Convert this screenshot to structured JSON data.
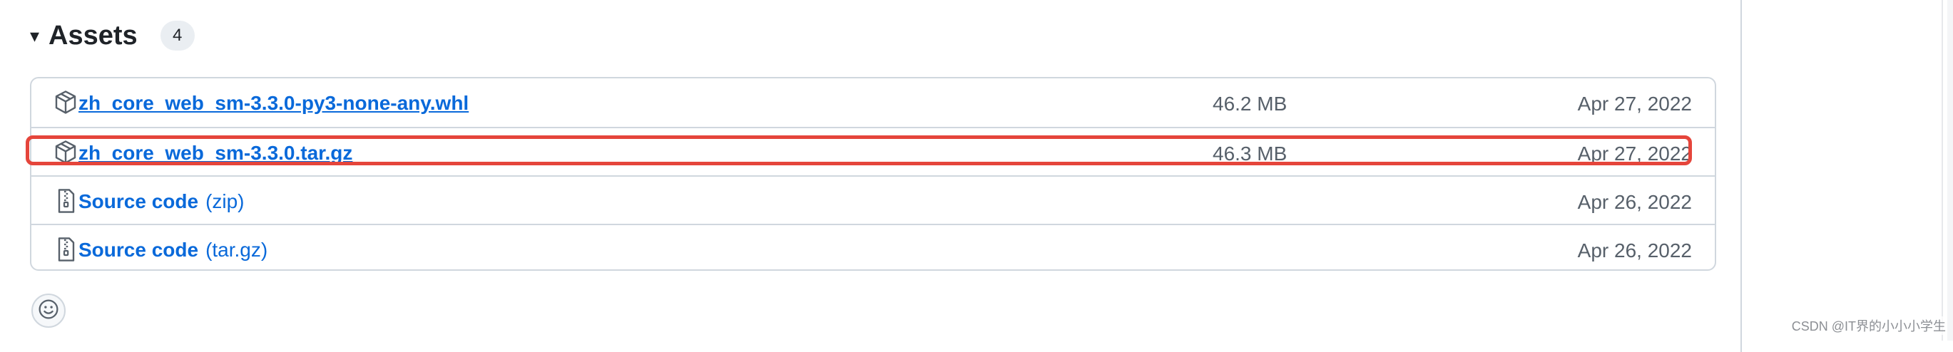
{
  "assets": {
    "title": "Assets",
    "count": "4",
    "items": [
      {
        "name": "zh_core_web_sm-3.3.0-py3-none-any.whl",
        "ext": "",
        "size": "46.2 MB",
        "date": "Apr 27, 2022",
        "icon": "package-icon"
      },
      {
        "name": "zh_core_web_sm-3.3.0.tar.gz",
        "ext": "",
        "size": "46.3 MB",
        "date": "Apr 27, 2022",
        "icon": "package-icon",
        "highlighted": true
      },
      {
        "name": "Source code",
        "ext": "(zip)",
        "size": "",
        "date": "Apr 26, 2022",
        "icon": "file-zip-icon"
      },
      {
        "name": "Source code",
        "ext": "(tar.gz)",
        "size": "",
        "date": "Apr 26, 2022",
        "icon": "file-zip-icon"
      }
    ]
  },
  "reaction": {
    "icon": "smiley-icon"
  },
  "watermark": "CSDN @IT界的小小小学生",
  "colors": {
    "link": "#0969da",
    "border": "#d0d7de",
    "highlight": "#e5453b",
    "muted": "#57606a"
  }
}
